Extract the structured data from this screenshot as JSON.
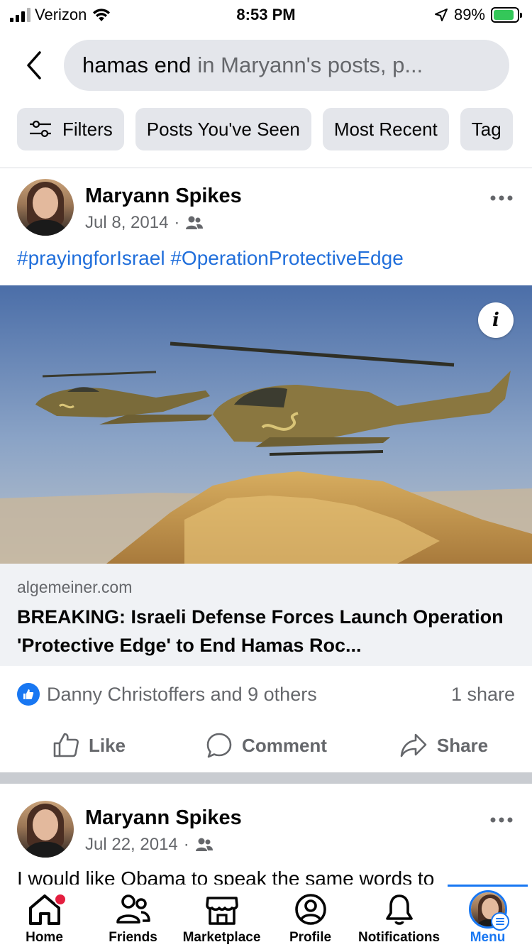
{
  "status_bar": {
    "carrier": "Verizon",
    "time": "8:53 PM",
    "battery": "89%",
    "battery_level": 0.89
  },
  "search": {
    "query": "hamas end",
    "scope": "in Maryann's posts, p..."
  },
  "filters": [
    {
      "label": "Filters",
      "icon": "sliders-icon"
    },
    {
      "label": "Posts You've Seen"
    },
    {
      "label": "Most Recent"
    },
    {
      "label": "Tag"
    }
  ],
  "posts": [
    {
      "author": "Maryann Spikes",
      "date": "Jul 8, 2014",
      "audience_icon": "friends-icon",
      "hashtags": [
        "#prayingforIsrael",
        "#OperationProtectiveEdge"
      ],
      "link": {
        "domain": "algemeiner.com",
        "title": "BREAKING: Israeli Defense Forces Launch Operation 'Protective Edge' to End Hamas Roc..."
      },
      "reactions_text": "Danny Christoffers and 9 others",
      "shares_text": "1 share",
      "actions": {
        "like": "Like",
        "comment": "Comment",
        "share": "Share"
      }
    },
    {
      "author": "Maryann Spikes",
      "date": "Jul 22, 2014",
      "audience_icon": "friends-icon",
      "text": "I would like Obama to speak the same words to"
    }
  ],
  "tab_bar": {
    "home": "Home",
    "friends": "Friends",
    "marketplace": "Marketplace",
    "profile": "Profile",
    "notifications": "Notifications",
    "menu": "Menu",
    "active": "menu"
  },
  "colors": {
    "accent": "#1877f2",
    "hashtag": "#216fdb",
    "notification_dot": "#e41e3f"
  }
}
